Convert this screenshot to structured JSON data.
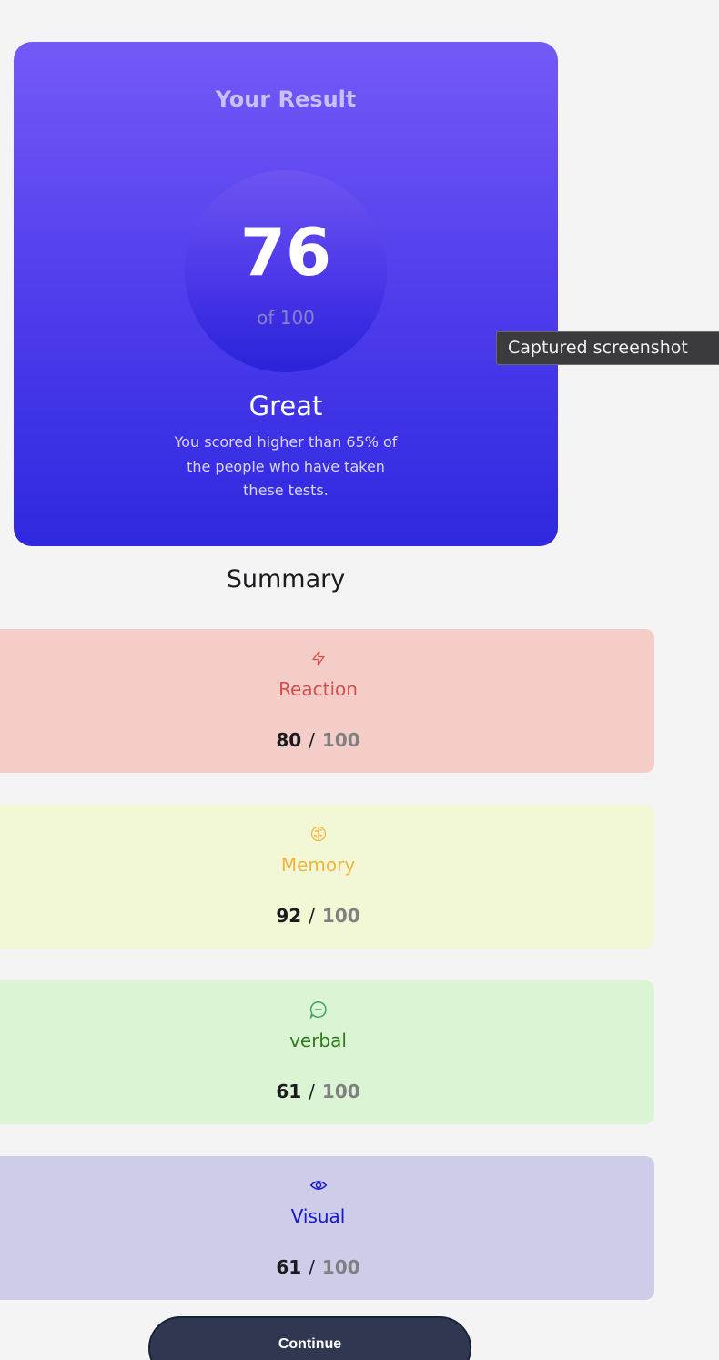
{
  "result": {
    "title": "Your Result",
    "score": "76",
    "out_of": "of 100",
    "rating": "Great",
    "description": "You scored higher than 65% of the people who have taken these tests."
  },
  "summary": {
    "heading": "Summary",
    "items": [
      {
        "label": "Reaction",
        "icon": "lightning-icon",
        "score": "80",
        "separator": "/",
        "max": "100",
        "color": "#d64f4f",
        "bg": "#f4cdc8"
      },
      {
        "label": "Memory",
        "icon": "brain-icon",
        "score": "92",
        "separator": "/",
        "max": "100",
        "color": "#f0b440",
        "bg": "#f2f7d5"
      },
      {
        "label": "verbal",
        "icon": "chat-bubble-icon",
        "score": "61",
        "separator": "/",
        "max": "100",
        "color": "#2f7a1a",
        "bg": "#dbf5d4"
      },
      {
        "label": "Visual",
        "icon": "eye-icon",
        "score": "61",
        "separator": "/",
        "max": "100",
        "color": "#1515d6",
        "bg": "#cdcde9"
      }
    ]
  },
  "tooltip": {
    "text": "Captured screenshot"
  },
  "actions": {
    "continue_label": "Continue"
  }
}
